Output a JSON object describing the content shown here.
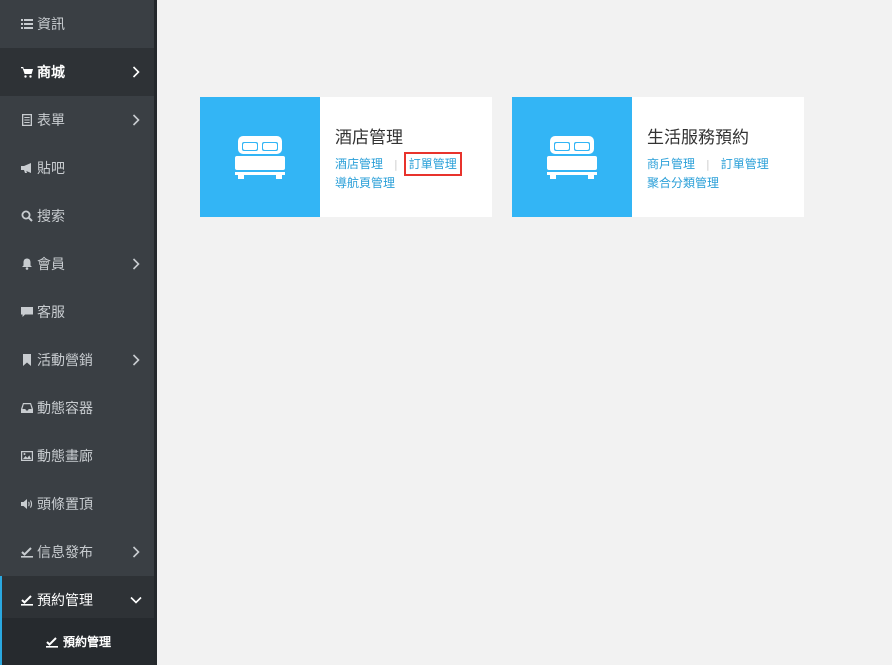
{
  "colors": {
    "sidebar_bg": "#3a3f44",
    "sidebar_active_bg": "#2e3236",
    "accent_blue": "#33b5f5",
    "link_blue": "#2a9fd8",
    "highlight_red": "#e8332c"
  },
  "sidebar": {
    "items": [
      {
        "label": "資訊",
        "icon": "list-icon"
      },
      {
        "label": "商城",
        "icon": "cart-icon"
      },
      {
        "label": "表單",
        "icon": "form-icon"
      },
      {
        "label": "貼吧",
        "icon": "bullhorn-icon"
      },
      {
        "label": "搜索",
        "icon": "search-icon"
      },
      {
        "label": "會員",
        "icon": "bell-icon"
      },
      {
        "label": "客服",
        "icon": "comment-icon"
      },
      {
        "label": "活動營銷",
        "icon": "bookmark-icon"
      },
      {
        "label": "動態容器",
        "icon": "inbox-icon"
      },
      {
        "label": "動態畫廊",
        "icon": "picture-icon"
      },
      {
        "label": "頭條置頂",
        "icon": "volume-icon"
      },
      {
        "label": "信息發布",
        "icon": "check-icon"
      },
      {
        "label": "預約管理",
        "icon": "check-icon"
      }
    ],
    "sub_item": {
      "label": "預約管理",
      "icon": "check-icon"
    }
  },
  "cards": [
    {
      "title": "酒店管理",
      "icon": "bed-icon",
      "links": [
        "酒店管理",
        "訂單管理",
        "導航頁管理"
      ]
    },
    {
      "title": "生活服務預約",
      "icon": "bed-icon",
      "links": [
        "商戶管理",
        "訂單管理",
        "聚合分類管理"
      ]
    }
  ]
}
